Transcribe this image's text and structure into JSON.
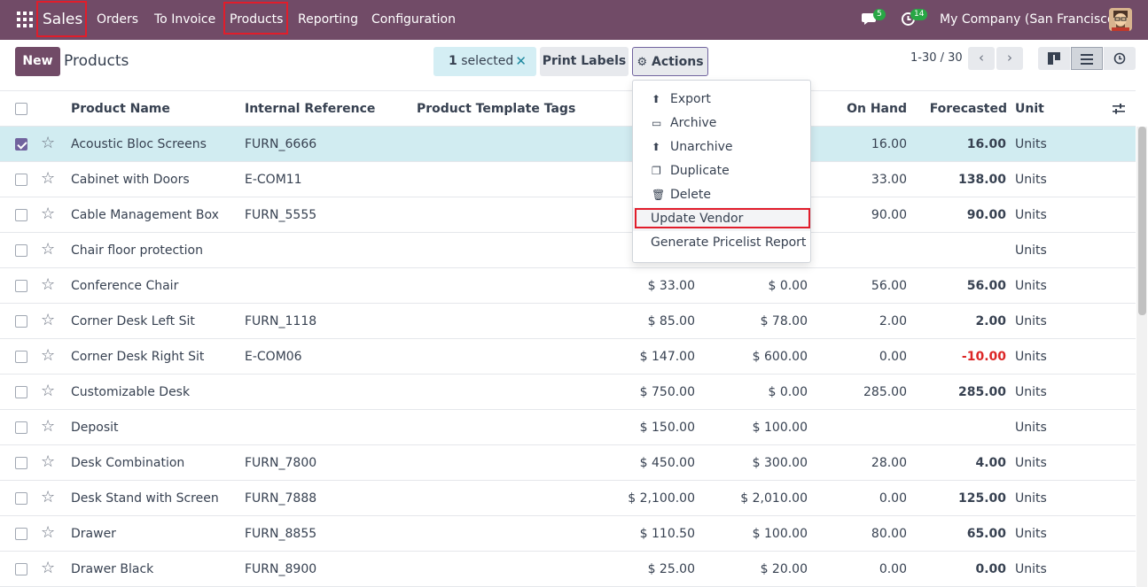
{
  "navbar": {
    "brand": "Sales",
    "menu": [
      "Orders",
      "To Invoice",
      "Products",
      "Reporting",
      "Configuration"
    ],
    "messages_count": "5",
    "activities_count": "14",
    "company": "My Company (San Francisco)"
  },
  "control": {
    "new_label": "New",
    "title": "Products",
    "selected_count": "1",
    "selected_text": "selected",
    "print_labels": "Print Labels",
    "actions": "Actions",
    "pager": "1-30 / 30"
  },
  "dropdown": {
    "items": [
      {
        "label": "Export",
        "icon": "upload-icon"
      },
      {
        "label": "Archive",
        "icon": "archive-icon"
      },
      {
        "label": "Unarchive",
        "icon": "unarchive-icon"
      },
      {
        "label": "Duplicate",
        "icon": "duplicate-icon"
      },
      {
        "label": "Delete",
        "icon": "trash-icon"
      },
      {
        "label": "Update Vendor",
        "icon": ""
      },
      {
        "label": "Generate Pricelist Report",
        "icon": ""
      }
    ]
  },
  "table": {
    "headers": {
      "name": "Product Name",
      "ref": "Internal Reference",
      "tags": "Product Template Tags",
      "on_hand": "On Hand",
      "forecasted": "Forecasted",
      "unit": "Unit"
    },
    "rows": [
      {
        "name": "Acoustic Bloc Screens",
        "ref": "FURN_6666",
        "price": "",
        "cost": "",
        "on_hand": "16.00",
        "forecasted": "16.00",
        "unit": "Units",
        "selected": true
      },
      {
        "name": "Cabinet with Doors",
        "ref": "E-COM11",
        "price": "",
        "cost": "",
        "on_hand": "33.00",
        "forecasted": "138.00",
        "unit": "Units"
      },
      {
        "name": "Cable Management Box",
        "ref": "FURN_5555",
        "price": "",
        "cost": "",
        "on_hand": "90.00",
        "forecasted": "90.00",
        "unit": "Units"
      },
      {
        "name": "Chair floor protection",
        "ref": "",
        "price": "",
        "cost": "",
        "on_hand": "",
        "forecasted": "",
        "unit": "Units"
      },
      {
        "name": "Conference Chair",
        "ref": "",
        "price": "$ 33.00",
        "cost": "$ 0.00",
        "on_hand": "56.00",
        "forecasted": "56.00",
        "unit": "Units"
      },
      {
        "name": "Corner Desk Left Sit",
        "ref": "FURN_1118",
        "price": "$ 85.00",
        "cost": "$ 78.00",
        "on_hand": "2.00",
        "forecasted": "2.00",
        "unit": "Units"
      },
      {
        "name": "Corner Desk Right Sit",
        "ref": "E-COM06",
        "price": "$ 147.00",
        "cost": "$ 600.00",
        "on_hand": "0.00",
        "forecasted": "-10.00",
        "unit": "Units",
        "negative": true
      },
      {
        "name": "Customizable Desk",
        "ref": "",
        "price": "$ 750.00",
        "cost": "$ 0.00",
        "on_hand": "285.00",
        "forecasted": "285.00",
        "unit": "Units"
      },
      {
        "name": "Deposit",
        "ref": "",
        "price": "$ 150.00",
        "cost": "$ 100.00",
        "on_hand": "",
        "forecasted": "",
        "unit": "Units"
      },
      {
        "name": "Desk Combination",
        "ref": "FURN_7800",
        "price": "$ 450.00",
        "cost": "$ 300.00",
        "on_hand": "28.00",
        "forecasted": "4.00",
        "unit": "Units"
      },
      {
        "name": "Desk Stand with Screen",
        "ref": "FURN_7888",
        "price": "$ 2,100.00",
        "cost": "$ 2,010.00",
        "on_hand": "0.00",
        "forecasted": "125.00",
        "unit": "Units"
      },
      {
        "name": "Drawer",
        "ref": "FURN_8855",
        "price": "$ 110.50",
        "cost": "$ 100.00",
        "on_hand": "80.00",
        "forecasted": "65.00",
        "unit": "Units"
      },
      {
        "name": "Drawer Black",
        "ref": "FURN_8900",
        "price": "$ 25.00",
        "cost": "$ 20.00",
        "on_hand": "0.00",
        "forecasted": "0.00",
        "unit": "Units"
      }
    ]
  }
}
